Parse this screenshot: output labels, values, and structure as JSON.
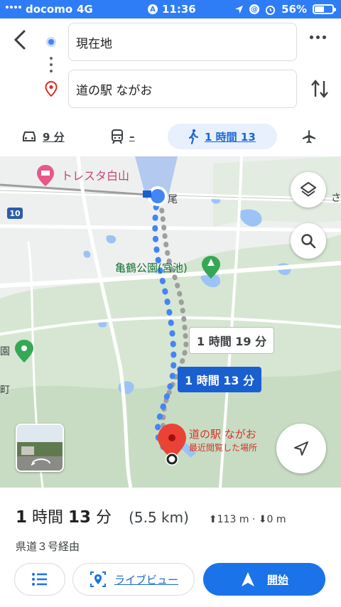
{
  "status_bar": {
    "carrier": "docomo",
    "network": "4G",
    "time": "11:36",
    "battery": "56%",
    "battery_level": 0.56
  },
  "search": {
    "origin": "現在地",
    "destination": "道の駅 ながお"
  },
  "tabs": {
    "car": "9 分",
    "transit": "–",
    "walk": "1 時間 13",
    "selected": "walk"
  },
  "map": {
    "labels": {
      "hotel": "トレスタ白山",
      "park": "亀鶴公園(宮池)",
      "station_suffix": "尾",
      "edge_sa": "さ",
      "edge_en": "園",
      "edge_machi": "町",
      "road_number": "10",
      "destination": "道の駅 ながお",
      "destination_sub": "最近閲覧した場所"
    },
    "alt_route": "1 時間 19 分",
    "main_route": "1 時間 13 分"
  },
  "route_summary": {
    "hours": "1",
    "hours_unit": "時間",
    "minutes": "13",
    "minutes_unit": "分",
    "distance": "(5.5 km)",
    "ascent": "113 m",
    "descent": "0 m",
    "via": "県道３号経由"
  },
  "actions": {
    "live_view": "ライブビュー",
    "start": "開始"
  },
  "colors": {
    "primary": "#1a73e8",
    "route": "#4285f4",
    "destination": "#d93025",
    "park": "#137333"
  }
}
